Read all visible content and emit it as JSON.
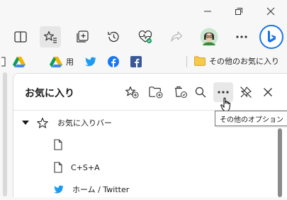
{
  "favorites_bar": {
    "item_3_label": "用",
    "other_favorites_label": "その他のお気に入り"
  },
  "panel": {
    "title": "お気に入り",
    "tooltip": "その他のオプション",
    "items": [
      {
        "label": "お気に入りバー",
        "icon": "star-outline-icon",
        "expanded": true
      },
      {
        "label": "",
        "icon": "page-icon"
      },
      {
        "label": "C+S+A",
        "icon": "page-icon"
      },
      {
        "label": "ホーム / Twitter",
        "icon": "twitter-icon"
      }
    ]
  },
  "colors": {
    "accent": "#0f6cbd",
    "google_drive_green": "#0f9d58",
    "google_drive_yellow": "#f4b400",
    "google_drive_blue": "#4285f4",
    "twitter_blue": "#1d9bf0",
    "facebook_blue": "#1877f2",
    "folder_yellow": "#f7c948",
    "bing_blue": "#1a73e8"
  }
}
